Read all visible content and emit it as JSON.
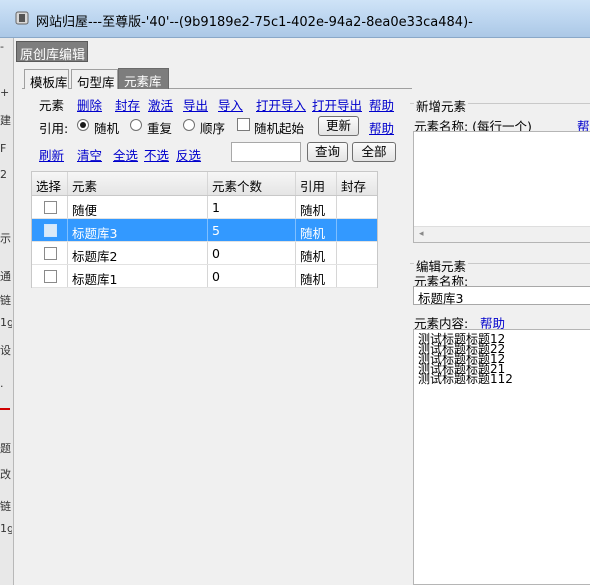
{
  "window": {
    "title": "网站归屋---至尊版-'40'--(9b9189e2-75c1-402e-94a2-8ea0e33ca484)-"
  },
  "page_tab": "原创库编辑",
  "tabs": [
    "模板库",
    "句型库",
    "元素库"
  ],
  "active_tab": 2,
  "toolbar": {
    "element_label": "元素",
    "links": [
      "删除",
      "封存",
      "激活",
      "导出",
      "导入",
      "打开导入",
      "打开导出"
    ],
    "help": "帮助"
  },
  "cite": {
    "label": "引用:",
    "options": [
      "随机",
      "重复",
      "顺序"
    ],
    "selected": 0,
    "random_start_label": "随机起始",
    "update_button": "更新",
    "help": "帮助"
  },
  "actions": {
    "links": [
      "刷新",
      "清空",
      "全选",
      "不选",
      "反选"
    ],
    "search_value": "",
    "query_button": "查询",
    "all_button": "全部"
  },
  "table": {
    "headers": [
      "选择",
      "元素",
      "元素个数",
      "引用",
      "封存"
    ],
    "rows": [
      {
        "name": "随便",
        "count": "1",
        "cite": "随机",
        "sealed": "",
        "selected": false
      },
      {
        "name": "标题库3",
        "count": "5",
        "cite": "随机",
        "sealed": "",
        "selected": true
      },
      {
        "name": "标题库2",
        "count": "0",
        "cite": "随机",
        "sealed": "",
        "selected": false
      },
      {
        "name": "标题库1",
        "count": "0",
        "cite": "随机",
        "sealed": "",
        "selected": false
      }
    ]
  },
  "new_element": {
    "group_title": "新增元素",
    "name_label": "元素名称: (每行一个)",
    "help": "帮"
  },
  "edit_element": {
    "group_title": "编辑元素",
    "name_label": "元素名称:",
    "name_value": "标题库3",
    "content_label": "元素内容:",
    "help": "帮助",
    "content_lines": [
      "测试标题标题12",
      "测试标题标题22",
      "测试标题标题12",
      "测试标题标题21",
      "测试标题标题112"
    ]
  },
  "background_window_glyphs": [
    "-",
    "+",
    "建",
    "F",
    "2",
    "示",
    "通",
    "链",
    "1g",
    "设",
    "·",
    "题",
    "改",
    "链",
    "1g"
  ]
}
